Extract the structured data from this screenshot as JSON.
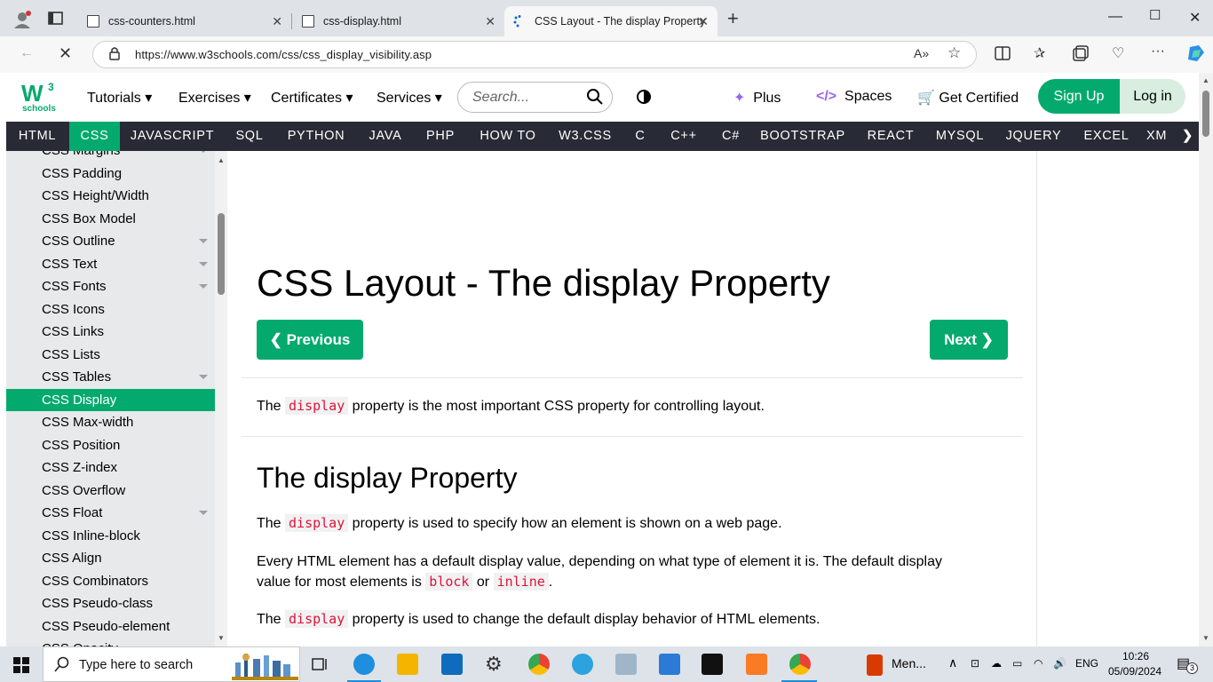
{
  "browser": {
    "tabs": [
      {
        "title": "css-counters.html"
      },
      {
        "title": "css-display.html"
      },
      {
        "title": "CSS Layout - The display Property"
      }
    ],
    "url": "https://www.w3schools.com/css/css_display_visibility.asp",
    "new_tab_label": "+"
  },
  "header": {
    "logo_text": "schools",
    "menu": {
      "tutorials": "Tutorials",
      "exercises": "Exercises",
      "certificates": "Certificates",
      "services": "Services"
    },
    "search_placeholder": "Search...",
    "plus": "Plus",
    "spaces": "Spaces",
    "get_certified": "Get Certified",
    "signup": "Sign Up",
    "login": "Log in"
  },
  "topnav": [
    "HTML",
    "CSS",
    "JAVASCRIPT",
    "SQL",
    "PYTHON",
    "JAVA",
    "PHP",
    "HOW TO",
    "W3.CSS",
    "C",
    "C++",
    "C#",
    "BOOTSTRAP",
    "REACT",
    "MYSQL",
    "JQUERY",
    "EXCEL",
    "XM"
  ],
  "sidebar": [
    {
      "label": "CSS Margins",
      "caret": true
    },
    {
      "label": "CSS Padding"
    },
    {
      "label": "CSS Height/Width"
    },
    {
      "label": "CSS Box Model"
    },
    {
      "label": "CSS Outline",
      "caret": true
    },
    {
      "label": "CSS Text",
      "caret": true
    },
    {
      "label": "CSS Fonts",
      "caret": true
    },
    {
      "label": "CSS Icons"
    },
    {
      "label": "CSS Links"
    },
    {
      "label": "CSS Lists"
    },
    {
      "label": "CSS Tables",
      "caret": true
    },
    {
      "label": "CSS Display",
      "active": true
    },
    {
      "label": "CSS Max-width"
    },
    {
      "label": "CSS Position"
    },
    {
      "label": "CSS Z-index"
    },
    {
      "label": "CSS Overflow"
    },
    {
      "label": "CSS Float",
      "caret": true
    },
    {
      "label": "CSS Inline-block"
    },
    {
      "label": "CSS Align"
    },
    {
      "label": "CSS Combinators"
    },
    {
      "label": "CSS Pseudo-class"
    },
    {
      "label": "CSS Pseudo-element"
    },
    {
      "label": "CSS Opacity"
    }
  ],
  "main": {
    "title": "CSS Layout - The display Property",
    "prev": "❮ Previous",
    "next": "Next ❯",
    "intro": {
      "a": "The ",
      "code": "display",
      "b": " property is the most important CSS property for controlling layout."
    },
    "h2": "The display Property",
    "p1": {
      "a": "The ",
      "code": "display",
      "b": " property is used to specify how an element is shown on a web page."
    },
    "p2": {
      "line1": "Every HTML element has a default display value, depending on what type of element it is. The default display",
      "a": "value for most elements is ",
      "code1": "block",
      "b": " or ",
      "code2": "inline",
      "c": "."
    },
    "p3": {
      "a": "The ",
      "code": "display",
      "b": " property is used to change the default display behavior of HTML elements."
    }
  },
  "taskbar": {
    "search_placeholder": "Type here to search",
    "menu_label": "Men...",
    "lang": "ENG",
    "time": "10:26",
    "date": "05/09/2024",
    "notifications": "3"
  },
  "colors": {
    "accent": "#04aa6d",
    "topnav": "#282a35",
    "code": "#dc143c"
  }
}
